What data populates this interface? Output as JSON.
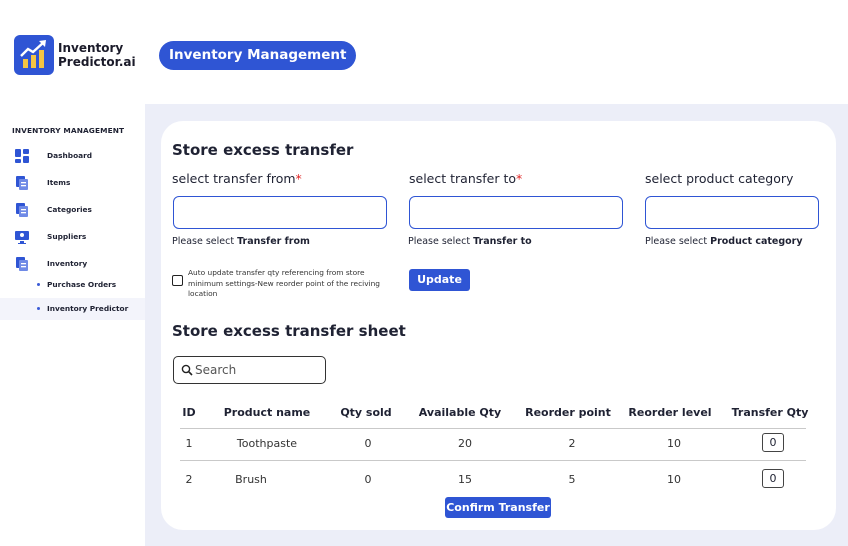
{
  "brand": {
    "name_line1": "Inventory",
    "name_line2": "Predictor.ai"
  },
  "header": {
    "title": "Inventory Management"
  },
  "sidebar": {
    "heading": "INVENTORY MANAGEMENT",
    "items": [
      {
        "label": "Dashboard",
        "icon": "dashboard-icon"
      },
      {
        "label": "Items",
        "icon": "items-icon"
      },
      {
        "label": "Categories",
        "icon": "categories-icon"
      },
      {
        "label": "Suppliers",
        "icon": "suppliers-icon"
      },
      {
        "label": "Inventory",
        "icon": "inventory-icon"
      }
    ],
    "subitems": [
      {
        "label": "Purchase Orders"
      },
      {
        "label": "Inventory Predictor"
      }
    ]
  },
  "transfer": {
    "title": "Store excess transfer",
    "from_label": "select transfer from",
    "to_label": "select transfer to",
    "category_label": "select product category",
    "required_mark": "*",
    "from_hint_prefix": "Please select ",
    "from_hint_bold": "Transfer from",
    "to_hint_prefix": "Please select ",
    "to_hint_bold": "Transfer to",
    "category_hint_prefix": "Please select ",
    "category_hint_bold": "Product category",
    "auto_update_text": "Auto update transfer qty referencing from store minimum settings-New reorder point of the reciving location",
    "update_label": "Update"
  },
  "sheet": {
    "title": "Store excess transfer sheet",
    "search_placeholder": "Search",
    "columns": [
      "ID",
      "Product name",
      "Qty sold",
      "Available Qty",
      "Reorder point",
      "Reorder level",
      "Transfer Qty"
    ],
    "rows": [
      {
        "id": "1",
        "product": "Toothpaste",
        "qty_sold": "0",
        "available": "20",
        "reorder_point": "2",
        "reorder_level": "10",
        "transfer_qty": "0"
      },
      {
        "id": "2",
        "product": "Brush",
        "qty_sold": "0",
        "available": "15",
        "reorder_point": "5",
        "reorder_level": "10",
        "transfer_qty": "0"
      }
    ],
    "confirm_label": "Confirm Transfer"
  },
  "colors": {
    "accent": "#2f55d4",
    "panel_bg": "#eceef8",
    "required": "#e02424"
  }
}
